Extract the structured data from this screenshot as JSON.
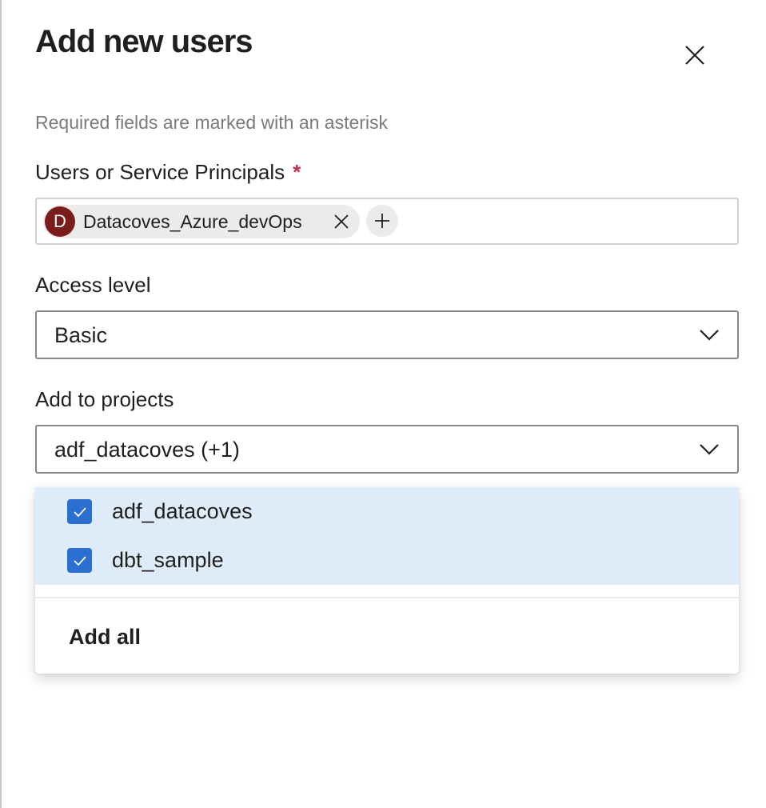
{
  "dialog": {
    "title": "Add new users",
    "hint": "Required fields are marked with an asterisk"
  },
  "users": {
    "label": "Users or Service Principals",
    "required_marker": "*",
    "chip": {
      "initial": "D",
      "name": "Datacoves_Azure_devOps",
      "avatar_color": "#7b1c1c"
    },
    "add_icon": "plus-icon"
  },
  "access_level": {
    "label": "Access level",
    "value": "Basic"
  },
  "projects": {
    "label": "Add to projects",
    "value": "adf_datacoves (+1)",
    "options": [
      {
        "label": "adf_datacoves",
        "checked": true
      },
      {
        "label": "dbt_sample",
        "checked": true
      }
    ],
    "add_all_label": "Add all"
  },
  "colors": {
    "accent": "#2b6fd1",
    "selected_bg": "#deecf9",
    "required": "#c4314b"
  }
}
